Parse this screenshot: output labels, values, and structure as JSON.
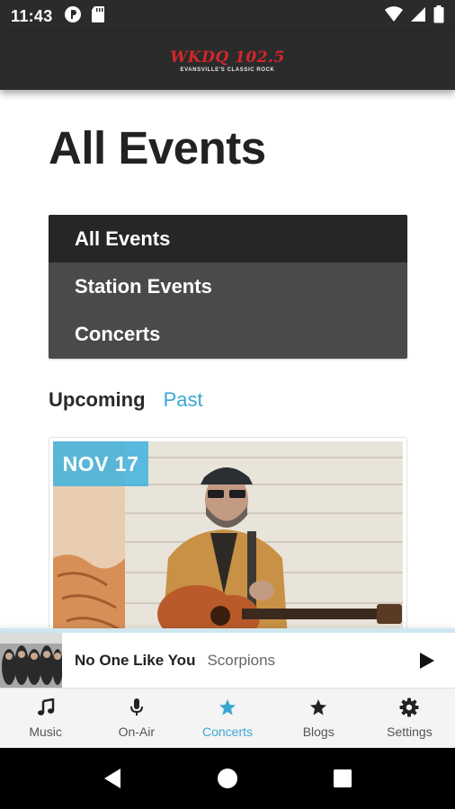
{
  "status_bar": {
    "time": "11:43",
    "left_icons": [
      "podcast-icon",
      "sd-card-icon"
    ],
    "right_icons": [
      "wifi-icon",
      "signal-icon",
      "battery-icon"
    ]
  },
  "header": {
    "logo_main": "WKDQ 102.5",
    "logo_sub": "EVANSVILLE'S CLASSIC ROCK"
  },
  "page": {
    "title": "All Events"
  },
  "filter_menu": {
    "items": [
      {
        "label": "All Events",
        "active": true
      },
      {
        "label": "Station Events",
        "active": false
      },
      {
        "label": "Concerts",
        "active": false
      }
    ]
  },
  "time_tabs": {
    "upcoming": "Upcoming",
    "past": "Past",
    "active": "upcoming"
  },
  "event_card": {
    "date": "NOV 17",
    "image": "musician-with-acoustic-guitar"
  },
  "now_playing": {
    "title": "No One Like You",
    "artist": "Scorpions",
    "control": "play-icon"
  },
  "bottom_nav": {
    "items": [
      {
        "label": "Music",
        "icon": "music-note-icon",
        "active": false
      },
      {
        "label": "On-Air",
        "icon": "microphone-icon",
        "active": false
      },
      {
        "label": "Concerts",
        "icon": "star-icon",
        "active": true
      },
      {
        "label": "Blogs",
        "icon": "star-icon",
        "active": false
      },
      {
        "label": "Settings",
        "icon": "gear-icon",
        "active": false
      }
    ]
  },
  "colors": {
    "accent": "#3aa7d2",
    "header_bg": "#2b2b2b",
    "menu_bg": "#4a4a4a",
    "menu_active_bg": "#262626",
    "badge": "#40b2de",
    "logo_red": "#d4262b"
  }
}
